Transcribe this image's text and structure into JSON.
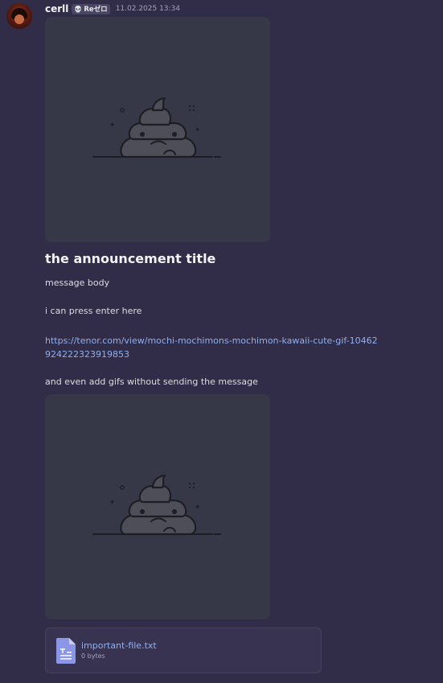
{
  "message": {
    "author": {
      "username": "cerll",
      "tag_icon": "skull-icon",
      "tag_text": "Reゼロ"
    },
    "timestamp": "11.02.2025 13:34",
    "gif_icon": "poop-emoji-icon",
    "title": "the announcement title",
    "body_lines": [
      "message body",
      "i can press enter here"
    ],
    "link": {
      "url": " https://tenor.com/view/mochi-mochimons-mochimon-kawaii-cute-gif-10462924222323919853"
    },
    "after_link_text": "and even add gifs without sending the message",
    "attachment": {
      "icon": "text-file-icon",
      "filename": "important-file.txt",
      "size": "0 bytes"
    }
  },
  "colors": {
    "background": "#312c48",
    "link": "#8fb0ee",
    "gif_placeholder": "#373847",
    "attachment_bg": "#383350"
  }
}
